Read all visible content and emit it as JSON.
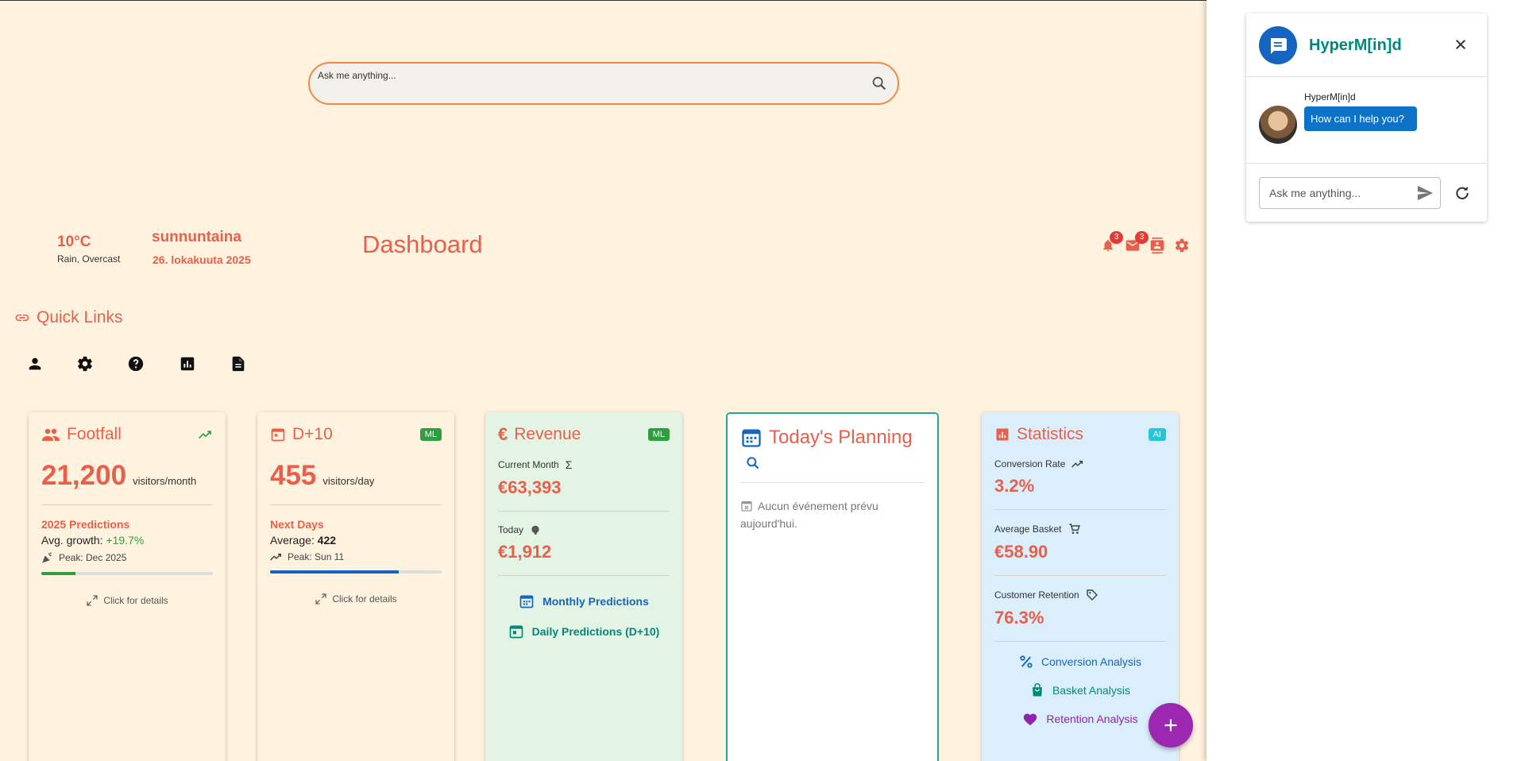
{
  "search": {
    "placeholder": "Ask me anything..."
  },
  "header": {
    "weather": {
      "temp": "10°C",
      "condition": "Rain, Overcast"
    },
    "day": "sunnuntaina",
    "date": "26. lokakuuta 2025",
    "title": "Dashboard",
    "notifications_count": "3",
    "messages_count": "3"
  },
  "quick_links": {
    "title": "Quick Links",
    "icons": [
      "person-icon",
      "settings-icon",
      "help-icon",
      "analytics-icon",
      "document-icon"
    ]
  },
  "cards": {
    "footfall": {
      "title": "Footfall",
      "value": "21,200",
      "unit": "visitors/month",
      "sub_title": "2025 Predictions",
      "growth_label": "Avg. growth:",
      "growth_value": "+19.7%",
      "peak": "Peak: Dec 2025",
      "progress": 0.2,
      "details": "Click for details"
    },
    "d10": {
      "title": "D+10",
      "tag": "ML",
      "value": "455",
      "unit": "visitors/day",
      "sub_title": "Next Days",
      "avg_label": "Average:",
      "avg_value": "422",
      "peak": "Peak: Sun 11",
      "progress": 0.75,
      "details": "Click for details"
    },
    "revenue": {
      "title": "Revenue",
      "tag": "ML",
      "current_month_label": "Current Month",
      "current_month_value": "€63,393",
      "today_label": "Today",
      "today_value": "€1,912",
      "monthly_link": "Monthly Predictions",
      "daily_link": "Daily Predictions (D+10)"
    },
    "planning": {
      "title": "Today's Planning",
      "empty": "Aucun événement prévu aujourd'hui."
    },
    "statistics": {
      "title": "Statistics",
      "tag": "AI",
      "conversion_label": "Conversion Rate",
      "conversion_value": "3.2%",
      "basket_label": "Average Basket",
      "basket_value": "€58.90",
      "retention_label": "Customer Retention",
      "retention_value": "76.3%",
      "conversion_link": "Conversion Analysis",
      "basket_link": "Basket Analysis",
      "retention_link": "Retention Analysis"
    }
  },
  "chat": {
    "title": "HyperM[in]d",
    "sender": "HyperM[in]d",
    "message": "How can I help you?",
    "input_placeholder": "Ask me anything..."
  },
  "colors": {
    "accent": "#e8604c",
    "background": "#fff3e0",
    "ml_tag": "#2e9e3e",
    "ai_tag": "#26c6da",
    "fab": "#9c27b0",
    "chat_blue": "#0d73c9",
    "teal": "#00897b"
  }
}
